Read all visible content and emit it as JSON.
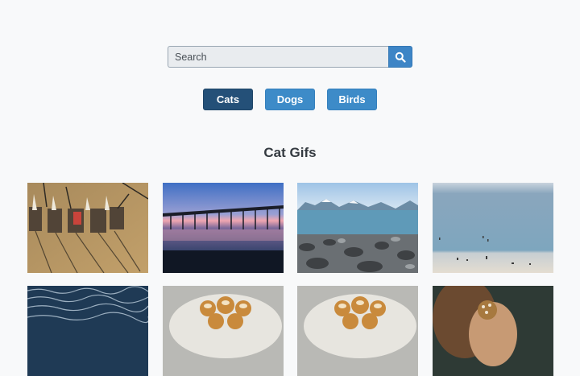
{
  "search": {
    "placeholder": "Search",
    "button_icon": "search-icon"
  },
  "filters": [
    {
      "label": "Cats",
      "active": true
    },
    {
      "label": "Dogs",
      "active": false
    },
    {
      "label": "Birds",
      "active": false
    }
  ],
  "section": {
    "title": "Cat Gifs"
  },
  "colors": {
    "accent": "#3d8bc8",
    "active": "#245078",
    "background": "#f8f9fa"
  },
  "gallery": [
    {
      "subject": "beach-chairs-on-sand"
    },
    {
      "subject": "pier-at-sunset"
    },
    {
      "subject": "rocky-shore-with-mountains"
    },
    {
      "subject": "people-on-beach"
    },
    {
      "subject": "ocean-waves"
    },
    {
      "subject": "cream-puffs-on-plate"
    },
    {
      "subject": "cream-puffs-on-plate"
    },
    {
      "subject": "person-holding-ice-cream"
    }
  ]
}
